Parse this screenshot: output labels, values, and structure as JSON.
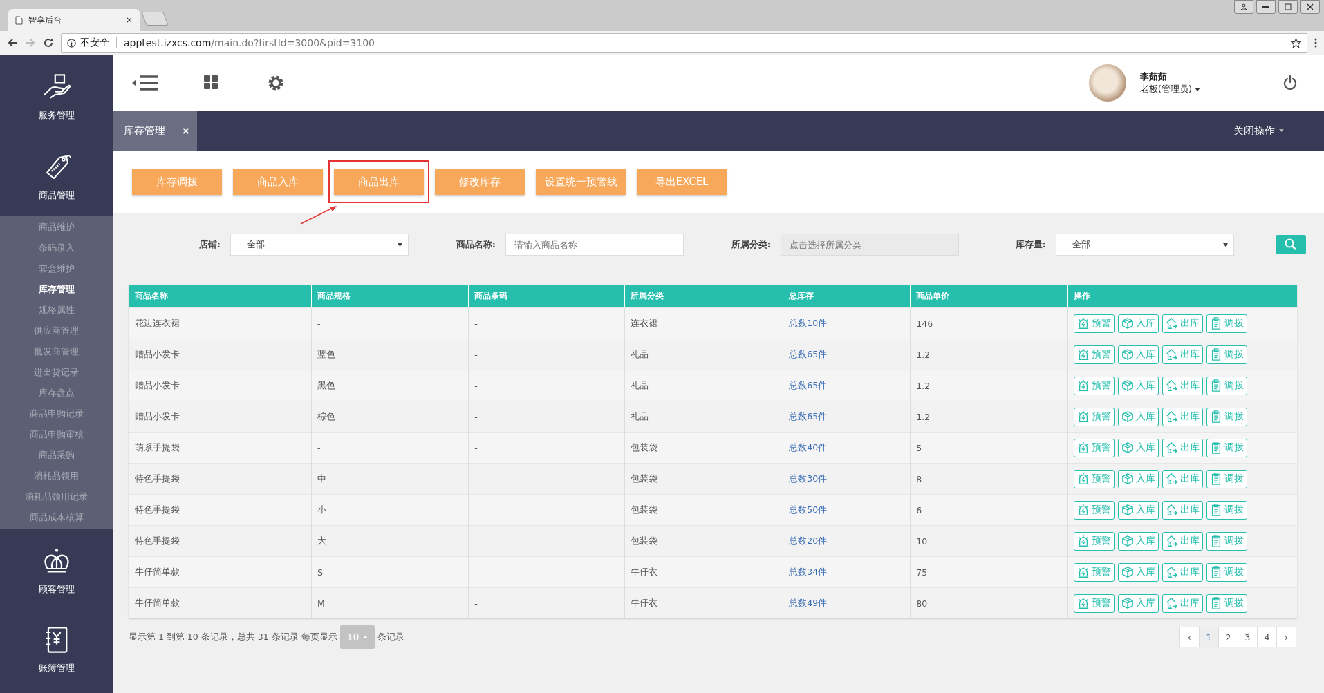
{
  "browser": {
    "tab_title": "智享后台",
    "tab_close": "×",
    "security": "不安全",
    "url_host": "apptest.izxcs.com",
    "url_path": "/main.do?firstId=3000&pid=3100"
  },
  "sidebar": {
    "sections": [
      {
        "label": "服务管理",
        "expanded": false
      },
      {
        "label": "商品管理",
        "expanded": true,
        "items": [
          {
            "label": "商品维护",
            "selected": false
          },
          {
            "label": "条码录入",
            "selected": false
          },
          {
            "label": "套盒维护",
            "selected": false
          },
          {
            "label": "库存管理",
            "selected": true
          },
          {
            "label": "规格属性",
            "selected": false
          },
          {
            "label": "供应商管理",
            "selected": false
          },
          {
            "label": "批发商管理",
            "selected": false
          },
          {
            "label": "进出货记录",
            "selected": false
          },
          {
            "label": "库存盘点",
            "selected": false
          },
          {
            "label": "商品申购记录",
            "selected": false
          },
          {
            "label": "商品申购审核",
            "selected": false
          },
          {
            "label": "商品采购",
            "selected": false
          },
          {
            "label": "消耗品领用",
            "selected": false
          },
          {
            "label": "消耗品领用记录",
            "selected": false
          },
          {
            "label": "商品成本核算",
            "selected": false
          }
        ]
      },
      {
        "label": "顾客管理",
        "expanded": false
      },
      {
        "label": "账簿管理",
        "expanded": false
      }
    ]
  },
  "header": {
    "user_name": "李茹茹",
    "user_role": "老板(管理员)"
  },
  "tabs": [
    {
      "label": "库存管理",
      "close": "×",
      "selected": true
    }
  ],
  "close_menu": "关闭操作",
  "toolbar": [
    {
      "label": "库存调拨",
      "highlighted": false
    },
    {
      "label": "商品入库",
      "highlighted": false
    },
    {
      "label": "商品出库",
      "highlighted": true
    },
    {
      "label": "修改库存",
      "highlighted": false
    },
    {
      "label": "设置统一预警线",
      "highlighted": false
    },
    {
      "label": "导出EXCEL",
      "highlighted": false
    }
  ],
  "filters": [
    {
      "kind": "select",
      "label": "店铺:",
      "value": "--全部--"
    },
    {
      "kind": "input",
      "label": "商品名称:",
      "placeholder": "请输入商品名称"
    },
    {
      "kind": "readonly",
      "label": "所属分类:",
      "placeholder": "点击选择所属分类"
    },
    {
      "kind": "select",
      "label": "库存量:",
      "value": "--全部--"
    }
  ],
  "table": {
    "columns": [
      "商品名称",
      "商品规格",
      "商品条码",
      "所属分类",
      "总库存",
      "商品单价",
      "操作"
    ],
    "rows": [
      {
        "cells": [
          "花边连衣裙",
          "-",
          "-",
          "连衣裙",
          "总数10件",
          "146"
        ],
        "actions": [
          "预警",
          "入库",
          "出库",
          "调拨"
        ]
      },
      {
        "cells": [
          "赠品小发卡",
          "蓝色",
          "-",
          "礼品",
          "总数65件",
          "1.2"
        ],
        "actions": [
          "预警",
          "入库",
          "出库",
          "调拨"
        ]
      },
      {
        "cells": [
          "赠品小发卡",
          "黑色",
          "-",
          "礼品",
          "总数65件",
          "1.2"
        ],
        "actions": [
          "预警",
          "入库",
          "出库",
          "调拨"
        ]
      },
      {
        "cells": [
          "赠品小发卡",
          "棕色",
          "-",
          "礼品",
          "总数65件",
          "1.2"
        ],
        "actions": [
          "预警",
          "入库",
          "出库",
          "调拨"
        ]
      },
      {
        "cells": [
          "萌系手提袋",
          "-",
          "-",
          "包装袋",
          "总数40件",
          "5"
        ],
        "actions": [
          "预警",
          "入库",
          "出库",
          "调拨"
        ]
      },
      {
        "cells": [
          "特色手提袋",
          "中",
          "-",
          "包装袋",
          "总数30件",
          "8"
        ],
        "actions": [
          "预警",
          "入库",
          "出库",
          "调拨"
        ]
      },
      {
        "cells": [
          "特色手提袋",
          "小",
          "-",
          "包装袋",
          "总数50件",
          "6"
        ],
        "actions": [
          "预警",
          "入库",
          "出库",
          "调拨"
        ]
      },
      {
        "cells": [
          "特色手提袋",
          "大",
          "-",
          "包装袋",
          "总数20件",
          "10"
        ],
        "actions": [
          "预警",
          "入库",
          "出库",
          "调拨"
        ]
      },
      {
        "cells": [
          "牛仔简单款",
          "S",
          "-",
          "牛仔衣",
          "总数34件",
          "75"
        ],
        "actions": [
          "预警",
          "入库",
          "出库",
          "调拨"
        ]
      },
      {
        "cells": [
          "牛仔简单款",
          "M",
          "-",
          "牛仔衣",
          "总数49件",
          "80"
        ],
        "actions": [
          "预警",
          "入库",
          "出库",
          "调拨"
        ]
      }
    ]
  },
  "footer": {
    "info": "显示第 1 到第 10 条记录，总共 31 条记录 每页显示",
    "page_size": "10",
    "info_suffix": "条记录",
    "pagination": {
      "prev": "‹",
      "pages": [
        {
          "label": "1",
          "selected": true
        },
        {
          "label": "2",
          "selected": false
        },
        {
          "label": "3",
          "selected": false
        },
        {
          "label": "4",
          "selected": false
        }
      ],
      "next": "›"
    }
  }
}
